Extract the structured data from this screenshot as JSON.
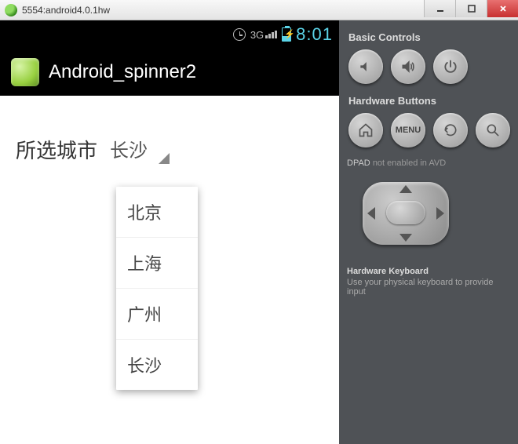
{
  "window": {
    "title": "5554:android4.0.1hw"
  },
  "status_bar": {
    "network_label": "3G",
    "time": "8:01"
  },
  "action_bar": {
    "title": "Android_spinner2"
  },
  "app": {
    "field_label": "所选城市",
    "spinner_value": "长沙",
    "options": [
      "北京",
      "上海",
      "广州",
      "长沙"
    ]
  },
  "panel": {
    "basic_controls_label": "Basic Controls",
    "hardware_buttons_label": "Hardware Buttons",
    "dpad_label": "DPAD",
    "dpad_note": "not enabled in AVD",
    "menu_label": "MENU",
    "hw_keyboard_title": "Hardware Keyboard",
    "hw_keyboard_note": "Use your physical keyboard to provide input"
  }
}
